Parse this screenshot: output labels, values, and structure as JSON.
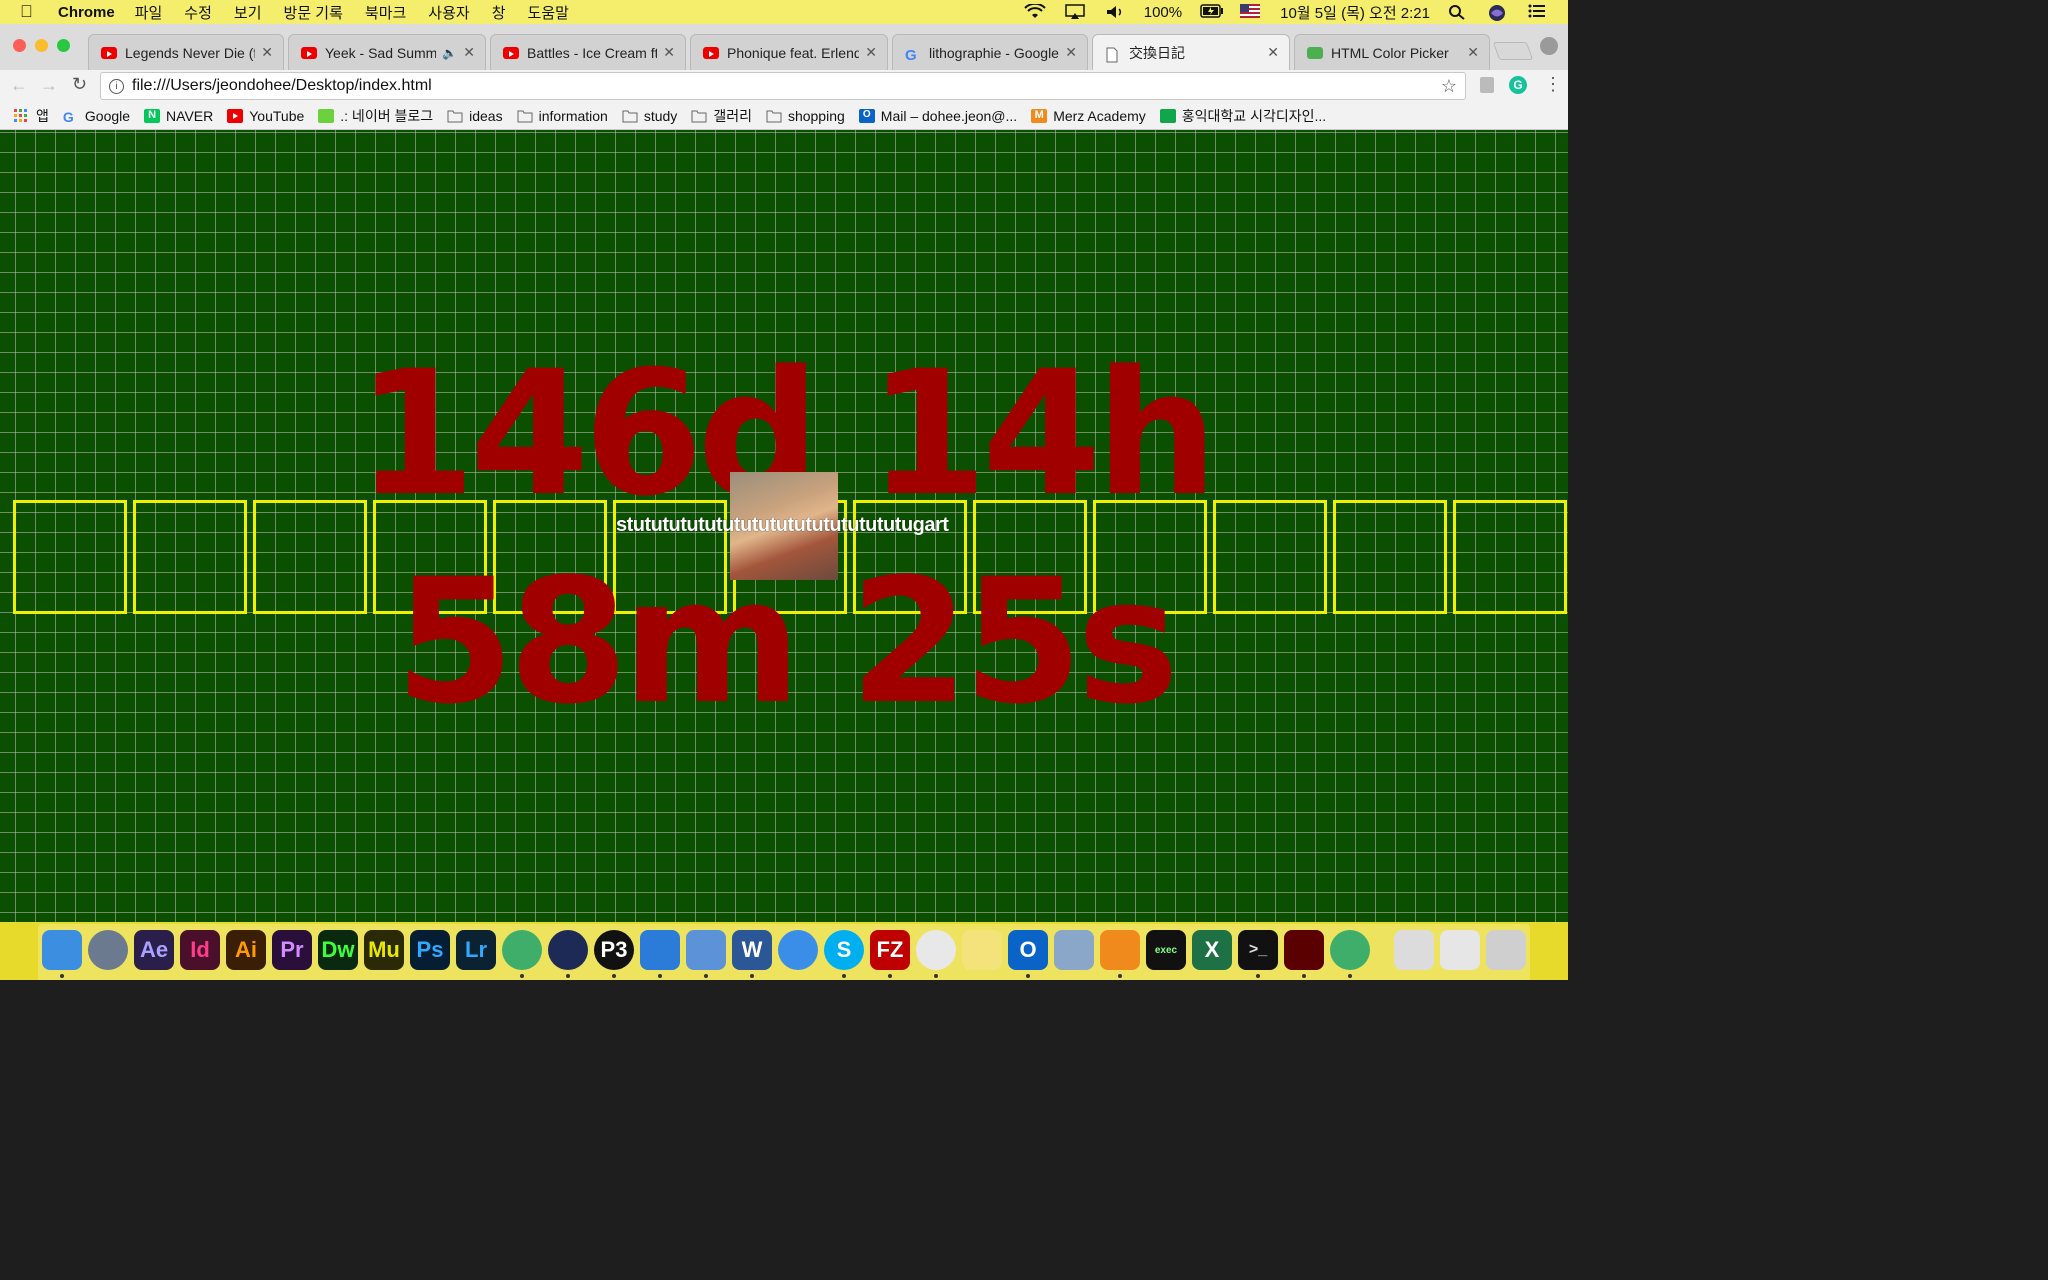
{
  "menubar": {
    "app_name": "Chrome",
    "items": [
      "파일",
      "수정",
      "보기",
      "방문 기록",
      "북마크",
      "사용자",
      "창",
      "도움말"
    ],
    "battery": "100%",
    "datetime": "10월 5일 (목) 오전 2:21"
  },
  "tabs": [
    {
      "title": "Legends Never Die (ft.",
      "icon": "youtube-icon"
    },
    {
      "title": "Yeek - Sad Summer",
      "icon": "youtube-icon"
    },
    {
      "title": "Battles - Ice Cream ft.",
      "icon": "youtube-icon"
    },
    {
      "title": "Phonique feat. Erlend O",
      "icon": "youtube-icon"
    },
    {
      "title": "lithographie - Google-S",
      "icon": "google-icon"
    },
    {
      "title": "交換日記",
      "icon": "document-icon"
    },
    {
      "title": "HTML Color Picker",
      "icon": "w3schools-icon"
    }
  ],
  "address_bar": {
    "url": "file:///Users/jeondohee/Desktop/index.html"
  },
  "bookmarks": [
    {
      "label": "앱",
      "icon": "apps-grid-icon"
    },
    {
      "label": "Google",
      "icon": "google-icon"
    },
    {
      "label": "NAVER",
      "icon": "naver-icon"
    },
    {
      "label": "YouTube",
      "icon": "youtube-icon"
    },
    {
      "label": ".: 네이버 블로그",
      "icon": "blog-icon"
    },
    {
      "label": "ideas",
      "icon": "folder-icon"
    },
    {
      "label": "information",
      "icon": "folder-icon"
    },
    {
      "label": "study",
      "icon": "folder-icon"
    },
    {
      "label": "갤러리",
      "icon": "folder-icon"
    },
    {
      "label": "shopping",
      "icon": "folder-icon"
    },
    {
      "label": "Mail – dohee.jeon@...",
      "icon": "outlook-icon"
    },
    {
      "label": "Merz Academy",
      "icon": "merz-icon"
    },
    {
      "label": "홍익대학교 시각디자인...",
      "icon": "hongik-icon"
    }
  ],
  "page": {
    "countdown_line1": "146d 14h",
    "countdown_line2": "58m 25s",
    "marquee_text": "stutututututututututututututututugart",
    "box_count": 13,
    "background_color": "#0b5000",
    "countdown_color": "#a00000",
    "box_border_color": "#f0f000"
  },
  "dock": [
    {
      "name": "finder-icon",
      "label": ""
    },
    {
      "name": "launchpad-icon",
      "label": ""
    },
    {
      "name": "after-effects-icon",
      "label": "Ae"
    },
    {
      "name": "indesign-icon",
      "label": "Id"
    },
    {
      "name": "illustrator-icon",
      "label": "Ai"
    },
    {
      "name": "premiere-icon",
      "label": "Pr"
    },
    {
      "name": "dreamweaver-icon",
      "label": "Dw"
    },
    {
      "name": "muse-icon",
      "label": "Mu"
    },
    {
      "name": "photoshop-icon",
      "label": "Ps"
    },
    {
      "name": "lightroom-icon",
      "label": "Lr"
    },
    {
      "name": "atom-icon",
      "label": ""
    },
    {
      "name": "cinema4d-icon",
      "label": ""
    },
    {
      "name": "processing-icon",
      "label": "P3"
    },
    {
      "name": "keynote-icon",
      "label": ""
    },
    {
      "name": "filezilla-alt-icon",
      "label": ""
    },
    {
      "name": "word-icon",
      "label": "W"
    },
    {
      "name": "safari-icon",
      "label": ""
    },
    {
      "name": "skype-icon",
      "label": "S"
    },
    {
      "name": "filezilla-icon",
      "label": "FZ"
    },
    {
      "name": "chrome-icon",
      "label": ""
    },
    {
      "name": "notes-icon",
      "label": ""
    },
    {
      "name": "outlook-icon",
      "label": "O"
    },
    {
      "name": "preview-icon",
      "label": ""
    },
    {
      "name": "vlc-icon",
      "label": ""
    },
    {
      "name": "exec-icon",
      "label": "exec"
    },
    {
      "name": "excel-icon",
      "label": "X"
    },
    {
      "name": "terminal-icon",
      "label": ">_"
    },
    {
      "name": "acrobat-icon",
      "label": ""
    },
    {
      "name": "atom-2-icon",
      "label": ""
    },
    {
      "name": "downloads-icon",
      "label": ""
    },
    {
      "name": "documents-icon",
      "label": ""
    },
    {
      "name": "trash-icon",
      "label": ""
    }
  ]
}
